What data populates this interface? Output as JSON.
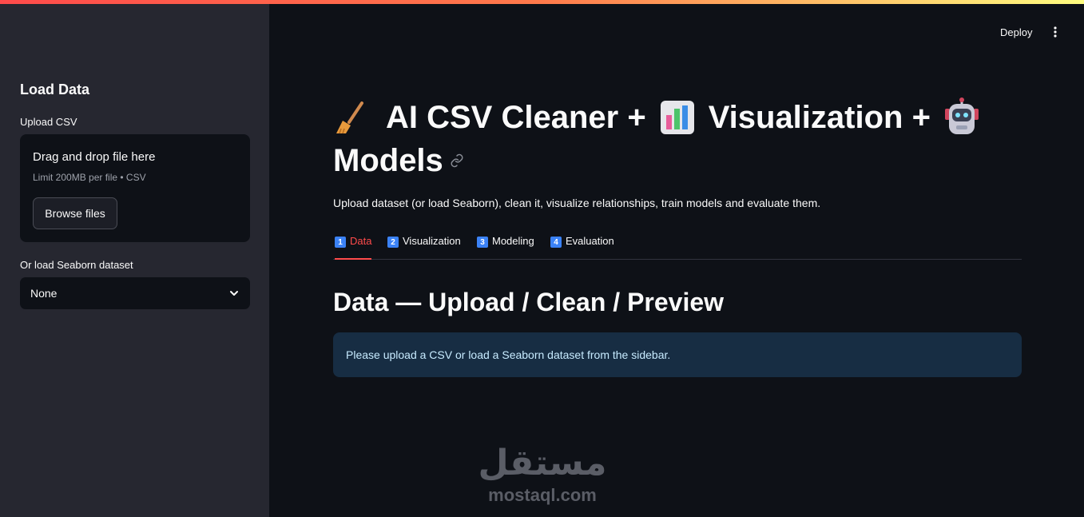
{
  "header": {
    "deploy_label": "Deploy",
    "menu_icon": "kebab-icon"
  },
  "sidebar": {
    "title": "Load Data",
    "upload_label": "Upload CSV",
    "dropzone": {
      "title": "Drag and drop file here",
      "limit": "Limit 200MB per file • CSV",
      "browse_label": "Browse files"
    },
    "seaborn_label": "Or load Seaborn dataset",
    "seaborn_select": {
      "value": "None",
      "icon": "chevron-down-icon"
    }
  },
  "main": {
    "title": {
      "part1": "AI CSV Cleaner +",
      "part2": "Visualization +",
      "part3": "Models",
      "icons": [
        "broom-icon",
        "bar-chart-icon",
        "robot-icon",
        "link-icon"
      ]
    },
    "subtitle": "Upload dataset (or load Seaborn), clean it, visualize relationships, train models and evaluate them.",
    "tabs": [
      {
        "num": "1",
        "label": "Data",
        "active": true
      },
      {
        "num": "2",
        "label": "Visualization",
        "active": false
      },
      {
        "num": "3",
        "label": "Modeling",
        "active": false
      },
      {
        "num": "4",
        "label": "Evaluation",
        "active": false
      }
    ],
    "section_title": "Data — Upload / Clean / Preview",
    "info_message": "Please upload a CSV or load a Seaborn dataset from the sidebar."
  },
  "watermark": {
    "arabic": "مستقل",
    "latin": "mostaql.com"
  },
  "colors": {
    "accent": "#ff4b4b",
    "background": "#0e1117",
    "sidebar": "#262730",
    "info_bg": "#172d43",
    "info_text": "#c7ebff"
  }
}
